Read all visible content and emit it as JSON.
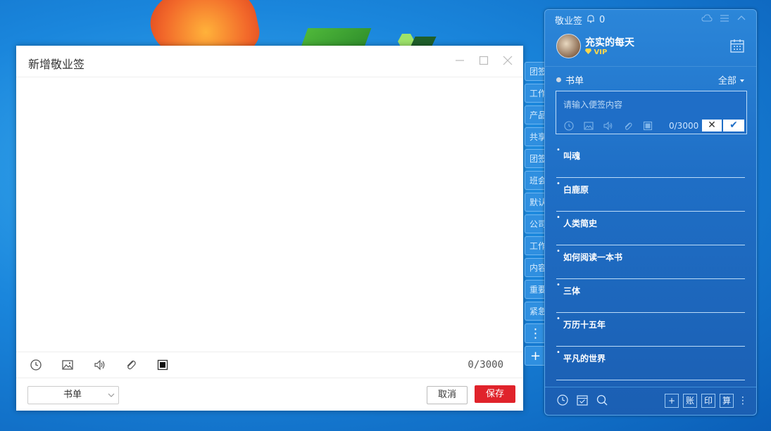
{
  "dialog": {
    "title": "新增敬业签",
    "char_count": "0/3000",
    "category": "书单",
    "cancel_label": "取消",
    "save_label": "保存"
  },
  "side_tabs": [
    "团签",
    "工作",
    "产品",
    "共享",
    "团签",
    "班会",
    "默认",
    "公司",
    "工作",
    "内容",
    "重要",
    "紧急"
  ],
  "panel": {
    "app_name": "敬业签",
    "notif_count": "0",
    "username": "充实的每天",
    "vip_label": "VIP",
    "book_label": "书单",
    "filter_label": "全部",
    "input_placeholder": "请输入便签内容",
    "input_count": "0/3000",
    "notes": [
      "叫魂",
      "白鹿原",
      "人类简史",
      "如何阅读一本书",
      "三体",
      "万历十五年",
      "平凡的世界"
    ],
    "footer_buttons": [
      "+",
      "账",
      "印",
      "算"
    ]
  },
  "colors": {
    "accent_red": "#e0232b",
    "panel_blue": "#1f6fc6"
  }
}
